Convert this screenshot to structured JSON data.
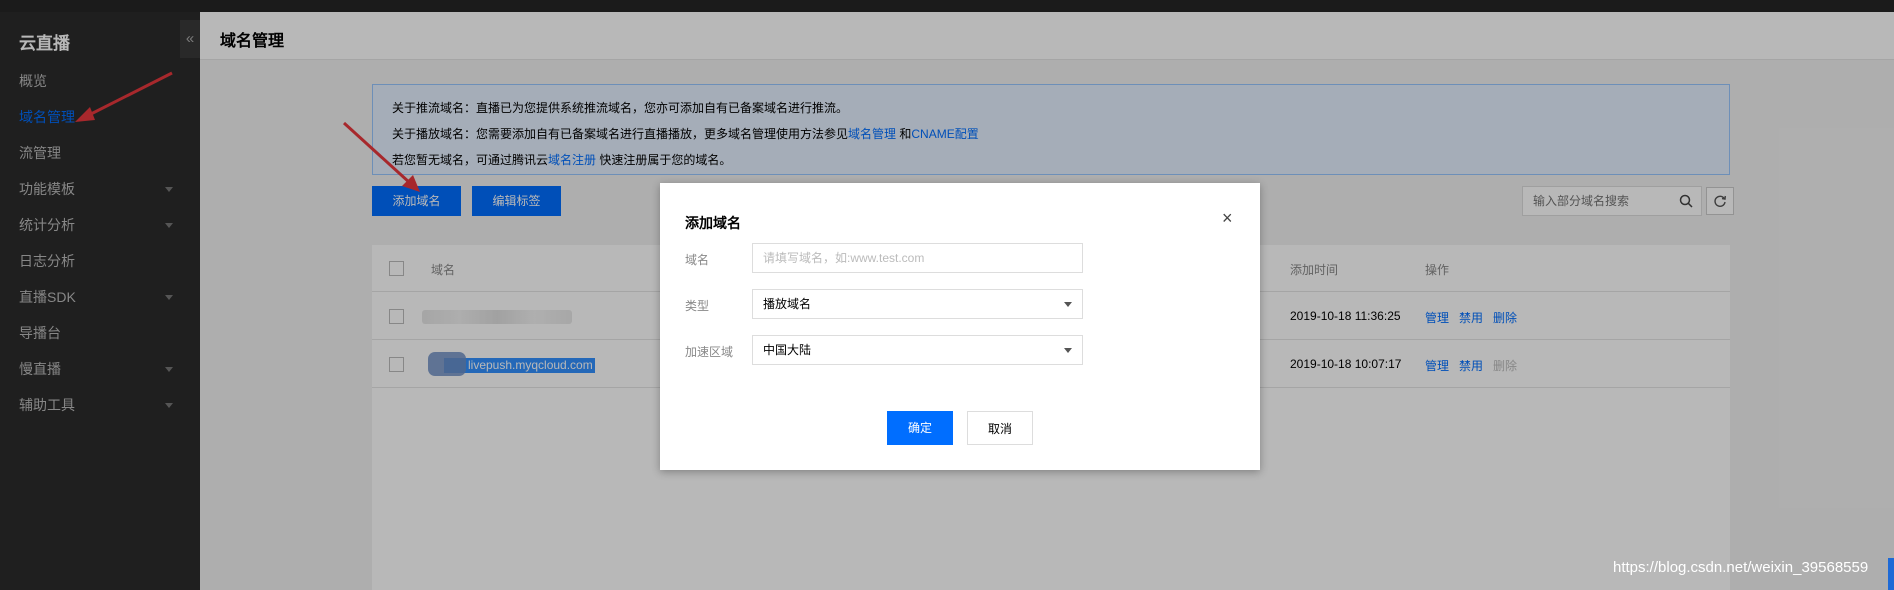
{
  "sidebar": {
    "title": "云直播",
    "collapse_icon": "«",
    "items": [
      {
        "label": "概览"
      },
      {
        "label": "域名管理"
      },
      {
        "label": "流管理"
      },
      {
        "label": "功能模板"
      },
      {
        "label": "统计分析"
      },
      {
        "label": "日志分析"
      },
      {
        "label": "直播SDK"
      },
      {
        "label": "导播台"
      },
      {
        "label": "慢直播"
      },
      {
        "label": "辅助工具"
      }
    ]
  },
  "header": {
    "title": "域名管理"
  },
  "notice": {
    "line1": "关于推流域名：直播已为您提供系统推流域名，您亦可添加自有已备案域名进行推流。",
    "line2_prefix": "关于播放域名：您需要添加自有已备案域名进行直播播放，更多域名管理使用方法参见",
    "line2_link1": "域名管理",
    "line2_and": " 和",
    "line2_link2": "CNAME配置",
    "line3_prefix": "若您暂无域名，可通过腾讯云",
    "line3_link": "域名注册",
    "line3_suffix": " 快速注册属于您的域名。"
  },
  "toolbar": {
    "add_domain": "添加域名",
    "edit_tags": "编辑标签",
    "search_placeholder": "输入部分域名搜索"
  },
  "table": {
    "headers": {
      "domain": "域名",
      "added_time": "添加时间",
      "actions": "操作"
    },
    "rows": [
      {
        "domain": "",
        "added_time": "2019-10-18 11:36:25",
        "ops": [
          "管理",
          "禁用",
          "删除"
        ]
      },
      {
        "domain": "livepush.myqcloud.com",
        "added_time": "2019-10-18 10:07:17",
        "ops": [
          "管理",
          "禁用",
          "删除"
        ]
      }
    ]
  },
  "modal": {
    "title": "添加域名",
    "close": "×",
    "fields": {
      "domain_label": "域名",
      "domain_placeholder": "请填写域名，如:www.test.com",
      "type_label": "类型",
      "type_value": "播放域名",
      "region_label": "加速区域",
      "region_value": "中国大陆"
    },
    "ok": "确定",
    "cancel": "取消"
  },
  "watermark": "https://blog.csdn.net/weixin_39568559",
  "colors": {
    "accent": "#006eff",
    "sidebar_bg": "#2b2b2b",
    "arrow": "#e8383d"
  }
}
